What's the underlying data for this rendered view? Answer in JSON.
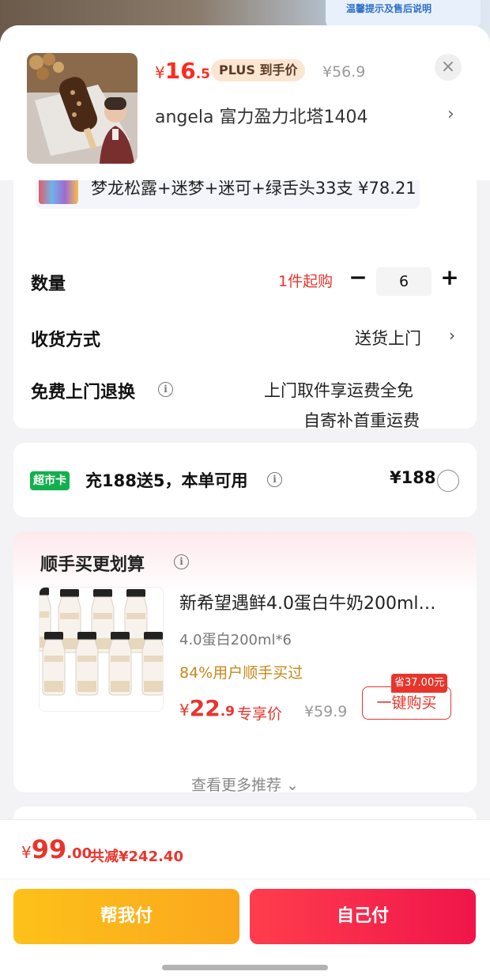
{
  "background_banner": {
    "title": "温馨提示及售后说明",
    "subtitle": "温馨提示及售后说明"
  },
  "product": {
    "image_icon": "ice-cream-bar-photo",
    "price_symbol": "¥",
    "price_int": "16",
    "price_dec": ".5",
    "plus_badge": "PLUS 到手价",
    "original_price": "¥56.9",
    "close_label": "×",
    "variant": "angela  富力盈力北塔1404",
    "variant_chevron": "›"
  },
  "previous_item": {
    "text": "梦龙松露+迷梦+迷可+绿舌头33支  ¥78.21"
  },
  "quantity": {
    "label": "数量",
    "min_buy": "1件起购",
    "minus": "−",
    "value": "6",
    "plus": "+"
  },
  "delivery": {
    "label": "收货方式",
    "value": "送货上门",
    "chevron": "›"
  },
  "free_return": {
    "label": "免费上门退换",
    "info_icon": "i",
    "line1": "上门取件享运费全免",
    "line2": "自寄补首重运费"
  },
  "supermarket_card": {
    "badge": "超市卡",
    "text": "充188送5，本单可用",
    "info_icon": "i",
    "price": "¥188"
  },
  "recommend": {
    "title": "顺手买更划算",
    "info_icon": "i",
    "item": {
      "name": "新希望遇鲜4.0蛋白牛奶200ml…",
      "spec": "4.0蛋白200ml*6",
      "users": "84%用户顺手买过",
      "price_symbol": "¥",
      "price_int": "22",
      "price_dec": ".9",
      "exclusive_label": "专享价",
      "original_price": "¥59.9",
      "save_tag": "省37.00元",
      "buy_button": "一键购买",
      "bottle_label": "4.0",
      "bottle_sub": "高钙牛乳"
    },
    "more_link": "查看更多推荐 ⌄"
  },
  "footer": {
    "price_symbol": "¥",
    "price_int": "99",
    "price_dec": ".00",
    "discount": "共减¥242.40",
    "help_pay": "帮我付",
    "self_pay": "自己付"
  },
  "colors": {
    "accent_red": "#e8352b",
    "price_red": "#ff2a1f",
    "green_badge": "#12b04d",
    "help_pay_yellow": "#fdc11a",
    "self_pay_red": "#ff3d4d"
  }
}
